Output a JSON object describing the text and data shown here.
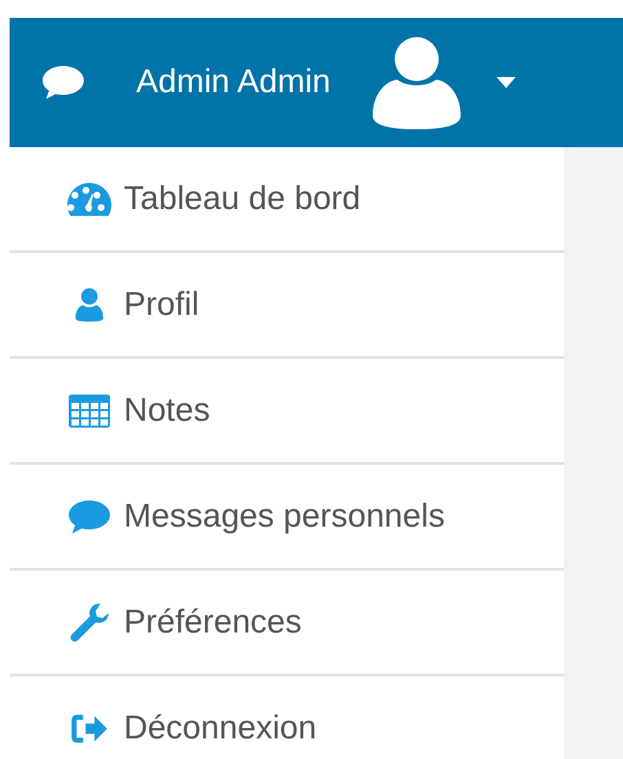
{
  "header": {
    "user_name": "Admin Admin"
  },
  "menu": [
    {
      "kind": "dashboard",
      "label": "Tableau de bord"
    },
    {
      "kind": "user",
      "label": "Profil"
    },
    {
      "kind": "table",
      "label": "Notes"
    },
    {
      "kind": "comment",
      "label": "Messages personnels"
    },
    {
      "kind": "wrench",
      "label": "Préférences"
    },
    {
      "kind": "signout",
      "label": "Déconnexion"
    }
  ]
}
